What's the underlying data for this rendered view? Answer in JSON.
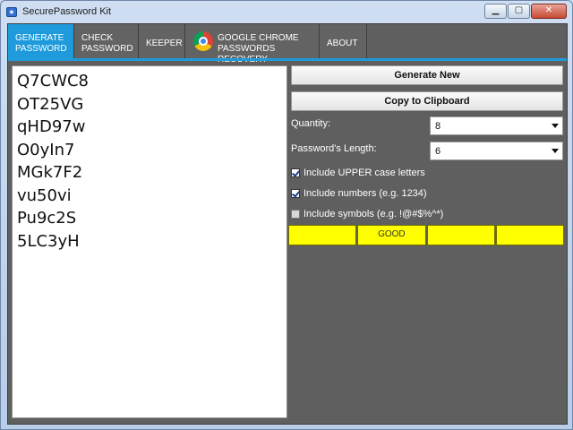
{
  "window": {
    "title": "SecurePassword Kit",
    "min_glyph": "▁",
    "max_glyph": "▢",
    "close_glyph": "✕"
  },
  "tabs": [
    {
      "line1": "Generate",
      "line2": "Password",
      "active": true
    },
    {
      "line1": "Check",
      "line2": "Password",
      "active": false
    },
    {
      "line1": "Keeper",
      "line2": "",
      "active": false
    },
    {
      "line1": "Google Chrome",
      "line2": "Passwords Recovery",
      "active": false
    },
    {
      "line1": "About",
      "line2": "",
      "active": false
    }
  ],
  "passwords": [
    "Q7CWC8",
    "OT25VG",
    "qHD97w",
    "O0yIn7",
    "MGk7F2",
    "vu50vi",
    "Pu9c2S",
    "5LC3yH"
  ],
  "actions": {
    "generate_label": "Generate New",
    "copy_label": "Copy to Clipboard"
  },
  "settings": {
    "quantity_label": "Quantity:",
    "quantity_value": "8",
    "length_label": "Password's Length:",
    "length_value": "6",
    "upper_label": "Include UPPER case letters",
    "upper_checked": true,
    "numbers_label": "Include numbers (e.g. 1234)",
    "numbers_checked": true,
    "symbols_label": "Include symbols (e.g. !@#$%^*)",
    "symbols_checked": false
  },
  "strength": {
    "segments": [
      "",
      "GOOD",
      "",
      ""
    ],
    "color": "#ffff00"
  },
  "colors": {
    "accent": "#1f9bdb",
    "panel": "#5f5f5f"
  }
}
